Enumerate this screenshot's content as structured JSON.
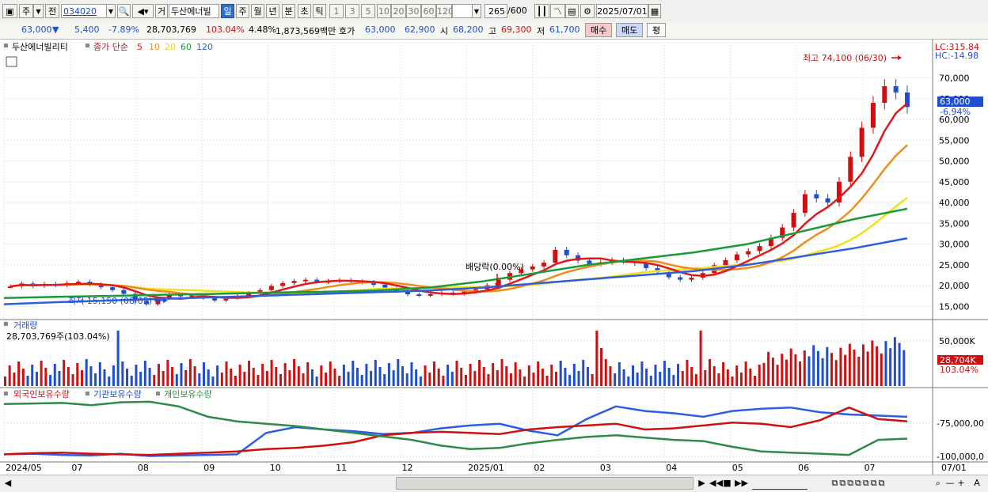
{
  "toolbar": {
    "market": "주",
    "prefix": "전",
    "code": "034020",
    "name_badge": "거",
    "stock_name": "두산에너빌",
    "periods": [
      "일",
      "주",
      "월",
      "년",
      "분",
      "초",
      "틱"
    ],
    "active_period": "일",
    "intervals": [
      "1",
      "3",
      "5",
      "10",
      "20",
      "30",
      "60",
      "120"
    ],
    "count": "265",
    "count_total": "/600",
    "date": "2025/07/01"
  },
  "quote": {
    "price": "63,000",
    "down_arrow": "▼",
    "change": "5,400",
    "change_pct": "-7.89%",
    "volume": "28,703,769",
    "volume_pct": "103.04%",
    "turnover_pct": "4.48%",
    "amount": "1,873,569백만",
    "bid_label": "호가",
    "bid": "63,000",
    "ask": "62,900",
    "open_label": "시",
    "open": "68,200",
    "high_label": "고",
    "high": "69,300",
    "low_label": "저",
    "low": "61,700",
    "buy": "매수",
    "sell": "매도",
    "eval": "평"
  },
  "legend": {
    "stock": "두산에너빌리티",
    "ma_label": "종가 단순",
    "ma_periods": [
      "5",
      "10",
      "20",
      "60",
      "120"
    ]
  },
  "colors": {
    "up": "#d01010",
    "down": "#1f4fd0",
    "ma5": "#e01818",
    "ma10": "#f08c1a",
    "ma20": "#f2e21a",
    "ma60": "#1a9a3a",
    "ma120": "#2a5fe0",
    "foreign": "#2a5fe0",
    "institution": "#d01010",
    "individual": "#2e8a4a"
  },
  "annotations": {
    "lc": "LC:315.84",
    "hc": "HC:-14.98",
    "high_note": "최고 74,100 (06/30)",
    "low_note": "최저 15,150 (08/05)",
    "dividend": "배당락(0.00%)",
    "last_price": "63,000",
    "last_pct": "-6.94%",
    "volume_title": "거래량",
    "volume_value": "28,703,769주(103.04%)",
    "volume_last": "28,704K",
    "volume_last_pct": "103.04%",
    "holdings_titles": [
      "외국인보유수량",
      "기관보유수량",
      "개인보유수량"
    ]
  },
  "chart_data": [
    {
      "type": "candlestick",
      "title": "두산에너빌리티",
      "x_labels": [
        "2024/05",
        "07",
        "08",
        "09",
        "10",
        "11",
        "12",
        "2025/01",
        "02",
        "03",
        "04",
        "05",
        "06",
        "07",
        "07/01"
      ],
      "price_axis": [
        15000,
        20000,
        25000,
        30000,
        35000,
        40000,
        45000,
        50000,
        55000,
        60000,
        65000,
        70000
      ],
      "ylim": [
        12000,
        76000
      ],
      "series_close": [
        19800,
        20500,
        19900,
        20400,
        20100,
        20600,
        20900,
        20300,
        19600,
        18900,
        18000,
        16300,
        15500,
        17000,
        17900,
        17400,
        17700,
        17000,
        16400,
        17000,
        17500,
        18200,
        18900,
        19900,
        20600,
        21100,
        21400,
        20900,
        21100,
        21300,
        21000,
        20800,
        20200,
        19500,
        18700,
        17900,
        17600,
        17900,
        18300,
        18000,
        18600,
        19100,
        20100,
        21400,
        23000,
        23900,
        24600,
        25500,
        28600,
        27300,
        26000,
        25200,
        25600,
        26100,
        25900,
        25400,
        24200,
        23200,
        22000,
        21400,
        21900,
        23000,
        24900,
        26100,
        27500,
        28300,
        29500,
        31500,
        34000,
        37500,
        42000,
        41000,
        40000,
        45000,
        51000,
        58000,
        64000,
        68000,
        66500,
        63000
      ],
      "ma_series": [
        "MA5",
        "MA10",
        "MA20",
        "MA60",
        "MA120"
      ],
      "ma60": [
        17000,
        17300,
        17500,
        17800,
        18000,
        18300,
        18500,
        18800,
        19500,
        21000,
        23000,
        25000,
        26500,
        28000,
        30000,
        33000,
        36000,
        38500
      ],
      "ma120": [
        15500,
        16000,
        16400,
        16800,
        17200,
        17600,
        18000,
        18400,
        18800,
        19500,
        20500,
        21500,
        22500,
        23500,
        25000,
        27000,
        29000,
        31400
      ],
      "max_note": {
        "value": 74100,
        "date": "06/30"
      },
      "min_note": {
        "value": 15150,
        "date": "08/05"
      },
      "last": 63000
    },
    {
      "type": "bar",
      "title": "거래량",
      "axis_label": "50,000K",
      "last_value": 28703769,
      "last_pct": 103.04
    },
    {
      "type": "line",
      "title": "보유수량",
      "series": [
        {
          "name": "외국인보유수량",
          "values": [
            5,
            6,
            4,
            3,
            6,
            2,
            3,
            4,
            5,
            42,
            52,
            48,
            45,
            40,
            42,
            50,
            55,
            58,
            46,
            38,
            66,
            88,
            80,
            76,
            70,
            80,
            84,
            86,
            78,
            74,
            72,
            70
          ]
        },
        {
          "name": "기관보유수량",
          "values": [
            5,
            7,
            8,
            6,
            5,
            4,
            6,
            8,
            10,
            14,
            16,
            20,
            26,
            38,
            42,
            44,
            42,
            40,
            48,
            52,
            55,
            58,
            48,
            50,
            55,
            60,
            58,
            52,
            64,
            86,
            66,
            62
          ]
        },
        {
          "name": "개인보유수량",
          "values": [
            92,
            93,
            94,
            90,
            95,
            96,
            88,
            70,
            62,
            58,
            54,
            48,
            42,
            36,
            30,
            20,
            14,
            16,
            24,
            30,
            35,
            38,
            34,
            30,
            28,
            18,
            10,
            8,
            6,
            4,
            30,
            32
          ]
        }
      ],
      "y_axis": [
        "-75,000,00",
        "-100,000,0"
      ]
    }
  ]
}
